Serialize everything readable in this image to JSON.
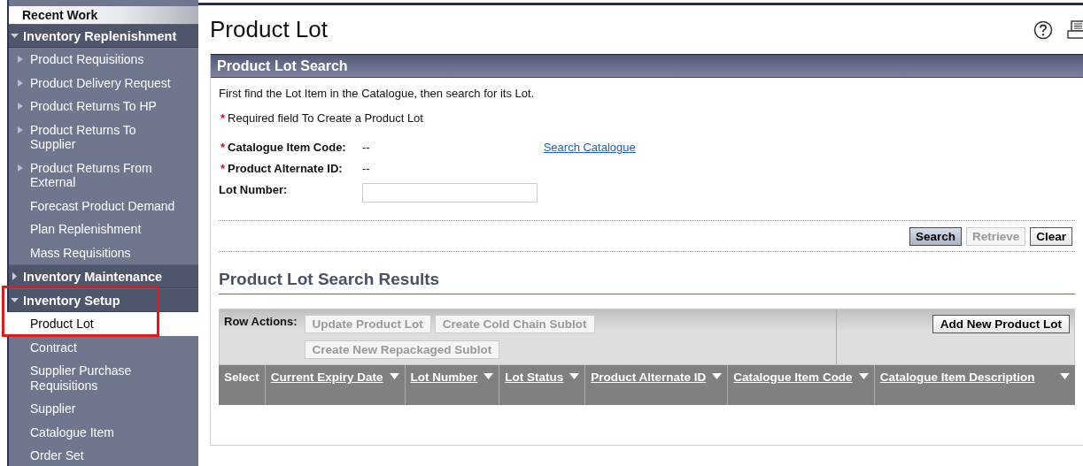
{
  "sidebar": {
    "recent": {
      "label": "Recent Work"
    },
    "sections": [
      {
        "label": "Inventory Replenishment",
        "expanded": true,
        "items": [
          {
            "label": "Product Requisitions",
            "kind": "submenu",
            "selected": false
          },
          {
            "label": "Product Delivery Request",
            "kind": "submenu",
            "selected": false
          },
          {
            "label": "Product Returns To HP",
            "kind": "submenu",
            "selected": false
          },
          {
            "label": "Product Returns To Supplier",
            "kind": "submenu",
            "selected": false
          },
          {
            "label": "Product Returns From External",
            "kind": "submenu",
            "selected": false
          },
          {
            "label": "Forecast Product Demand",
            "kind": "link",
            "selected": false
          },
          {
            "label": "Plan Replenishment",
            "kind": "link",
            "selected": false
          },
          {
            "label": "Mass Requisitions",
            "kind": "link",
            "selected": false
          }
        ]
      },
      {
        "label": "Inventory Maintenance",
        "expanded": false
      },
      {
        "label": "Inventory Setup",
        "expanded": true,
        "highlighted": true,
        "items": [
          {
            "label": "Product Lot",
            "kind": "link",
            "selected": true
          },
          {
            "label": "Contract",
            "kind": "link",
            "selected": false
          },
          {
            "label": "Supplier Purchase Requisitions",
            "kind": "link",
            "selected": false
          },
          {
            "label": "Supplier",
            "kind": "link",
            "selected": false
          },
          {
            "label": "Catalogue Item",
            "kind": "link",
            "selected": false
          },
          {
            "label": "Order Set",
            "kind": "link",
            "selected": false
          }
        ]
      }
    ]
  },
  "page": {
    "title": "Product Lot"
  },
  "search_panel": {
    "title": "Product Lot Search",
    "intro": "First find the Lot Item in the Catalogue, then search for its Lot.",
    "required_note": {
      "mark": "*",
      "text": "Required field To Create a Product Lot"
    },
    "fields": [
      {
        "kind": "readonly",
        "mark": "*",
        "label": "Catalogue Item Code:",
        "value": "--",
        "link": "Search Catalogue"
      },
      {
        "kind": "readonly",
        "mark": "*",
        "label": "Product Alternate ID:",
        "value": "--"
      },
      {
        "kind": "input",
        "label": "Lot Number:"
      }
    ],
    "buttons": [
      {
        "label": "Search",
        "kind": "primary",
        "disabled": false
      },
      {
        "label": "Retrieve",
        "kind": "normal",
        "disabled": true
      },
      {
        "label": "Clear",
        "kind": "normal",
        "disabled": false
      }
    ]
  },
  "results": {
    "title": "Product Lot Search Results",
    "row_actions_label": "Row Actions:",
    "row_actions": [
      {
        "label": "Update Product Lot",
        "disabled": true
      },
      {
        "label": "Create Cold Chain Sublot",
        "disabled": true
      },
      {
        "label": "Create New Repackaged Sublot",
        "disabled": true
      }
    ],
    "add_button": {
      "label": "Add New Product Lot",
      "disabled": false
    },
    "columns": [
      {
        "label": "Select",
        "sortable": false
      },
      {
        "label": "Current Expiry Date",
        "sortable": true
      },
      {
        "label": "Lot Number",
        "sortable": true
      },
      {
        "label": "Lot Status",
        "sortable": true
      },
      {
        "label": "Product Alternate ID",
        "sortable": true
      },
      {
        "label": "Catalogue Item Code",
        "sortable": true
      },
      {
        "label": "Catalogue Item Description",
        "sortable": true
      }
    ]
  }
}
